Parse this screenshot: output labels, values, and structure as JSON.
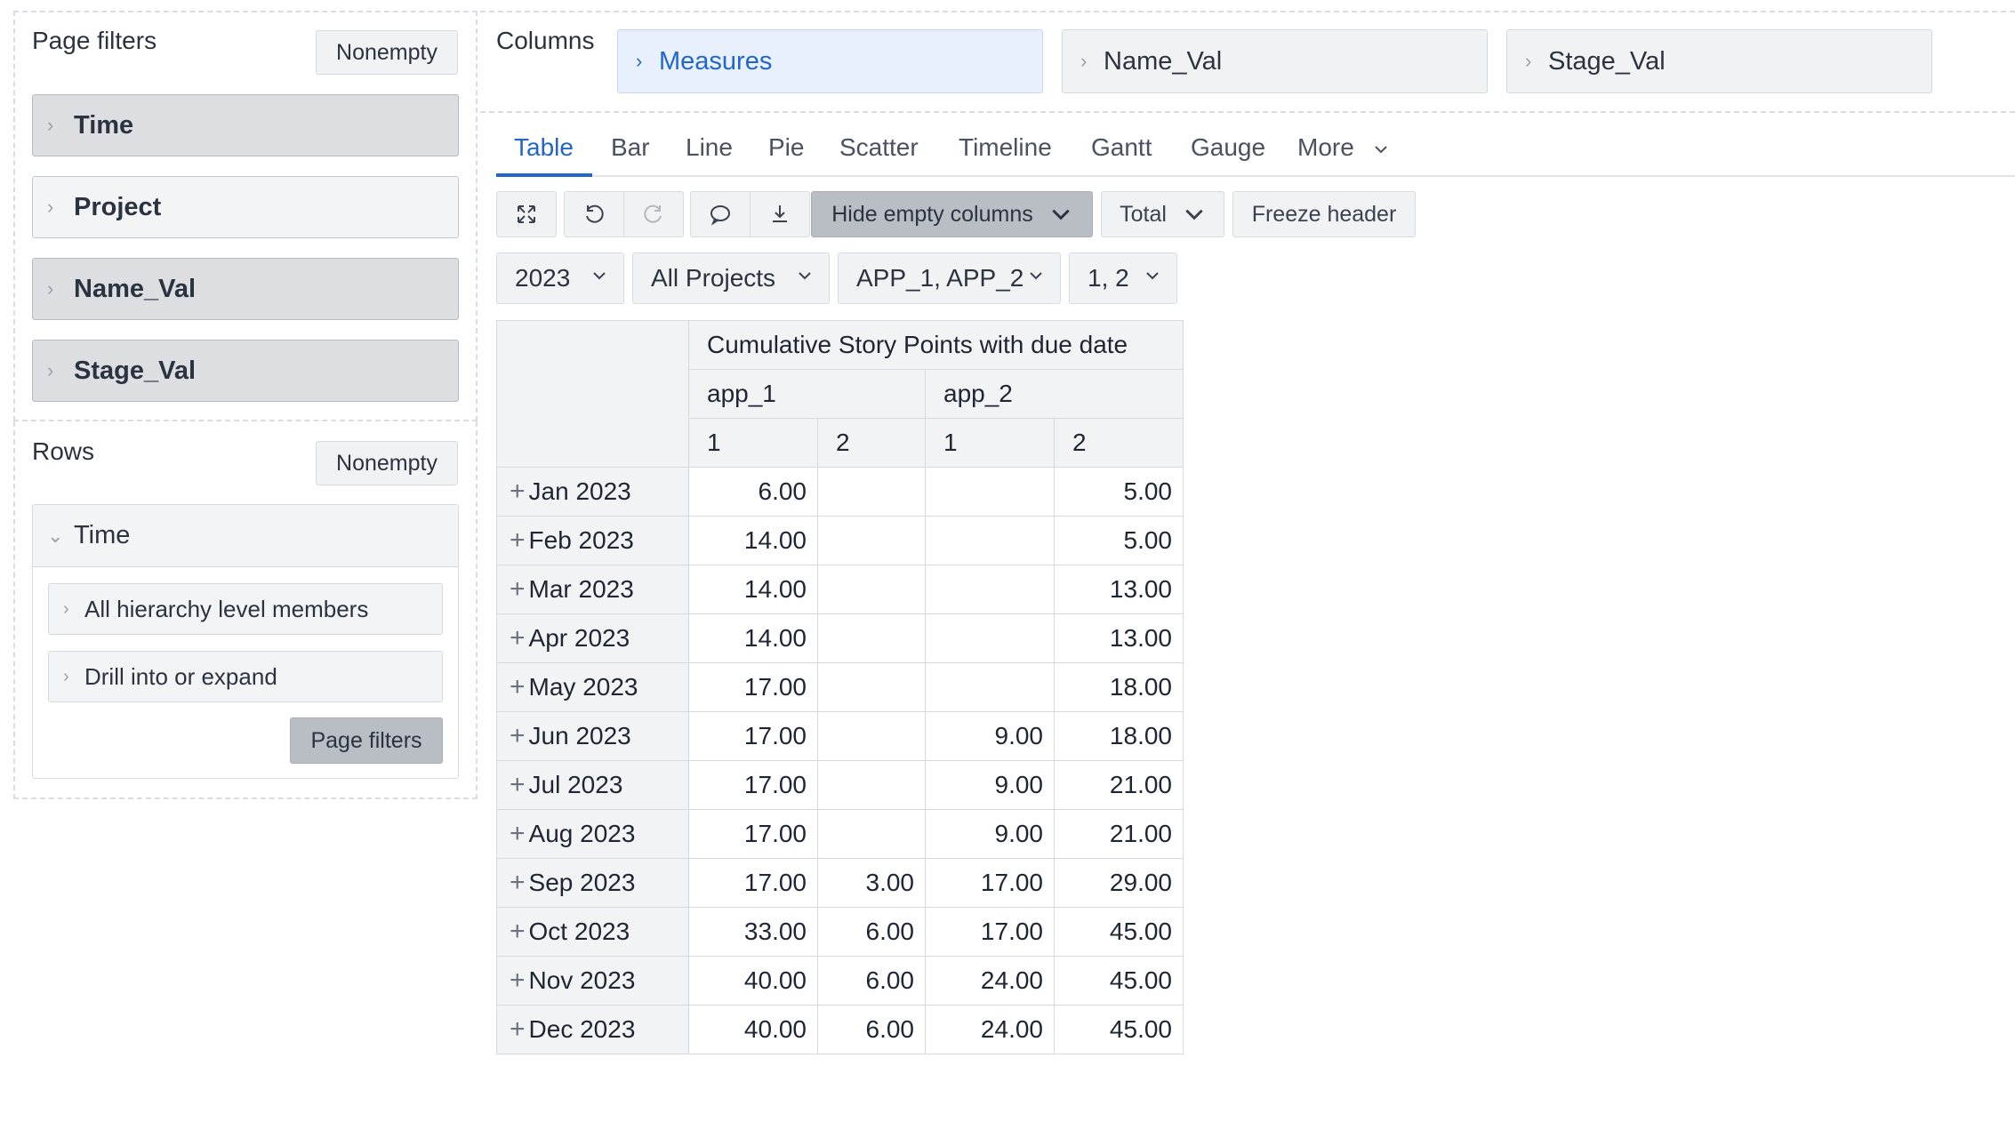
{
  "page_filters": {
    "title": "Page filters",
    "nonempty_label": "Nonempty",
    "items": [
      {
        "label": "Time",
        "style": "dark"
      },
      {
        "label": "Project",
        "style": "light"
      },
      {
        "label": "Name_Val",
        "style": "dark"
      },
      {
        "label": "Stage_Val",
        "style": "dark"
      }
    ]
  },
  "rows": {
    "title": "Rows",
    "nonempty_label": "Nonempty",
    "dimension": {
      "label": "Time",
      "options": [
        "All hierarchy level members",
        "Drill into or expand"
      ],
      "page_filters_button": "Page filters"
    }
  },
  "columns": {
    "title": "Columns",
    "chips": [
      "Measures",
      "Name_Val",
      "Stage_Val"
    ]
  },
  "tabs": [
    "Table",
    "Bar",
    "Line",
    "Pie",
    "Scatter",
    "Timeline",
    "Gantt",
    "Gauge",
    "More"
  ],
  "active_tab": "Table",
  "toolbar": {
    "hide_empty_label": "Hide empty columns",
    "total_label": "Total",
    "freeze_label": "Freeze header"
  },
  "selectors": [
    "2023",
    "All Projects",
    "APP_1, APP_2",
    "1, 2"
  ],
  "table": {
    "measure": "Cumulative Story Points with due date",
    "apps": [
      "app_1",
      "app_2"
    ],
    "stages": [
      "1",
      "2",
      "1",
      "2"
    ],
    "rows": [
      {
        "label": "Jan 2023",
        "cells": [
          "6.00",
          "",
          "",
          "5.00"
        ]
      },
      {
        "label": "Feb 2023",
        "cells": [
          "14.00",
          "",
          "",
          "5.00"
        ]
      },
      {
        "label": "Mar 2023",
        "cells": [
          "14.00",
          "",
          "",
          "13.00"
        ]
      },
      {
        "label": "Apr 2023",
        "cells": [
          "14.00",
          "",
          "",
          "13.00"
        ]
      },
      {
        "label": "May 2023",
        "cells": [
          "17.00",
          "",
          "",
          "18.00"
        ]
      },
      {
        "label": "Jun 2023",
        "cells": [
          "17.00",
          "",
          "9.00",
          "18.00"
        ]
      },
      {
        "label": "Jul 2023",
        "cells": [
          "17.00",
          "",
          "9.00",
          "21.00"
        ]
      },
      {
        "label": "Aug 2023",
        "cells": [
          "17.00",
          "",
          "9.00",
          "21.00"
        ]
      },
      {
        "label": "Sep 2023",
        "cells": [
          "17.00",
          "3.00",
          "17.00",
          "29.00"
        ]
      },
      {
        "label": "Oct 2023",
        "cells": [
          "33.00",
          "6.00",
          "17.00",
          "45.00"
        ]
      },
      {
        "label": "Nov 2023",
        "cells": [
          "40.00",
          "6.00",
          "24.00",
          "45.00"
        ]
      },
      {
        "label": "Dec 2023",
        "cells": [
          "40.00",
          "6.00",
          "24.00",
          "45.00"
        ]
      }
    ]
  }
}
